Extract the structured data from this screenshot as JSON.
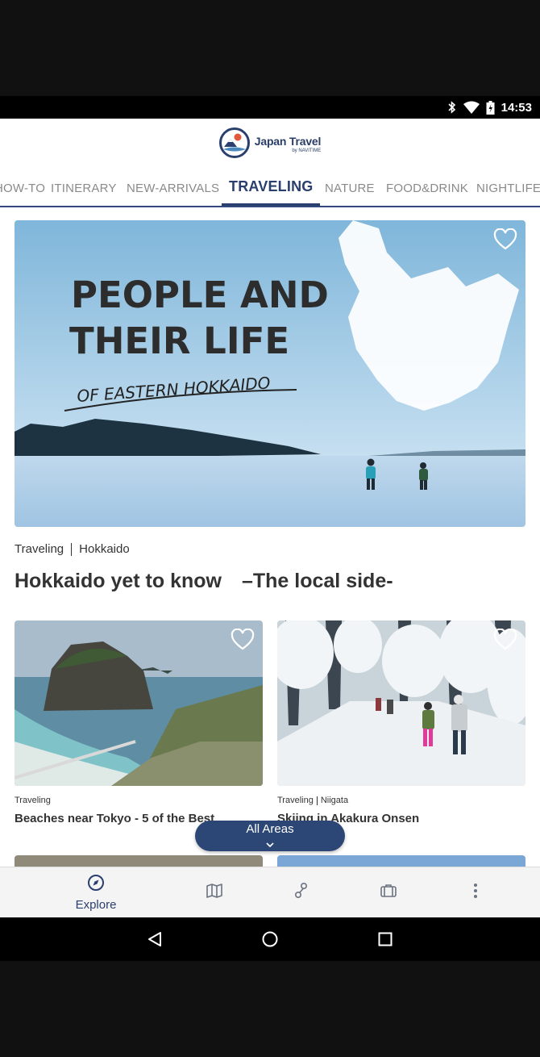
{
  "status_bar": {
    "time": "14:53"
  },
  "brand": {
    "name": "Japan Travel",
    "sub": "by NAVITIME"
  },
  "tabs": [
    {
      "label": "HOW-TO"
    },
    {
      "label": "ITINERARY"
    },
    {
      "label": "NEW-ARRIVALS"
    },
    {
      "label": "TRAVELING"
    },
    {
      "label": "NATURE"
    },
    {
      "label": "FOOD&DRINK"
    },
    {
      "label": "NIGHTLIFE"
    }
  ],
  "hero": {
    "image_text_line1": "PEOPLE AND",
    "image_text_line2": "THEIR LIFE",
    "image_text_line3": "OF EASTERN HOKKAIDO",
    "category": "Traveling",
    "area": "Hokkaido",
    "title": "Hokkaido yet to know　–The local side-"
  },
  "cards": [
    {
      "category": "Traveling",
      "area": "",
      "title": "Beaches near Tokyo - 5 of the Best"
    },
    {
      "category": "Traveling",
      "area": "Niigata",
      "title": "Skiing in Akakura Onsen"
    }
  ],
  "area_button": {
    "label": "All Areas"
  },
  "bottom_nav": {
    "explore_label": "Explore"
  },
  "colors": {
    "brand_navy": "#2a3f6e",
    "tab_inactive": "#8a8a8a",
    "button_bg": "#2c4776"
  }
}
